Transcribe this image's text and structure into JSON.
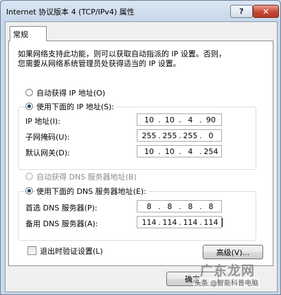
{
  "window": {
    "title": "Internet 协议版本 4 (TCP/IPv4) 属性",
    "help_label": "?",
    "close_label": "✕"
  },
  "tabs": [
    {
      "label": "常规",
      "active": true
    }
  ],
  "description": {
    "line1": "如果网络支持此功能，则可以获取自动指派的 IP 设置。否则，",
    "line2": "您需要从网络系统管理员处获得适当的 IP 设置。"
  },
  "ip_section": {
    "auto_option": {
      "label": "自动获得 IP 地址(O)",
      "checked": false
    },
    "manual_option": {
      "label": "使用下面的 IP 地址(S):",
      "checked": true
    },
    "fields": [
      {
        "label": "IP 地址(I):",
        "octets": [
          "10",
          "10",
          "4",
          "90"
        ]
      },
      {
        "label": "子网掩码(U):",
        "octets": [
          "255",
          "255",
          "255",
          "0"
        ]
      },
      {
        "label": "默认网关(D):",
        "octets": [
          "10",
          "10",
          "4",
          "254"
        ]
      }
    ]
  },
  "dns_section": {
    "auto_option": {
      "label": "自动获得 DNS 服务器地址(B)",
      "checked": false,
      "disabled": true
    },
    "manual_option": {
      "label": "使用下面的 DNS 服务器地址(E):",
      "checked": true
    },
    "fields": [
      {
        "label": "首选 DNS 服务器(P):",
        "octets": [
          "8",
          "8",
          "8",
          "8"
        ]
      },
      {
        "label": "备用 DNS 服务器(A):",
        "octets": [
          "114",
          "114",
          "114",
          "114"
        ]
      }
    ]
  },
  "validate_checkbox": {
    "label": "退出时验证设置(L)",
    "checked": false
  },
  "buttons": {
    "advanced": "高级(V)...",
    "ok": "确定"
  },
  "watermark": {
    "brand": "广东龙网",
    "caption": "头条 @智能科普电脑"
  }
}
